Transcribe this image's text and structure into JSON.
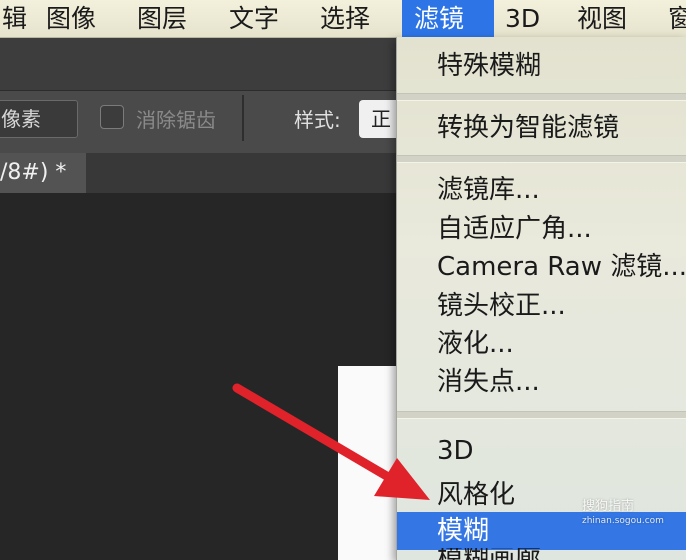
{
  "menubar": {
    "items": [
      {
        "label": "辑"
      },
      {
        "label": "图像"
      },
      {
        "label": "图层"
      },
      {
        "label": "文字"
      },
      {
        "label": "选择"
      },
      {
        "label": "滤镜"
      },
      {
        "label": "3D"
      },
      {
        "label": "视图"
      },
      {
        "label": "窗"
      }
    ]
  },
  "options_bar": {
    "feather_value": "像素",
    "antialias_label": "消除锯齿",
    "style_label": "样式:",
    "style_value": "正"
  },
  "document_tab": {
    "title": "/8#) *"
  },
  "filter_menu": {
    "items": [
      {
        "label": "特殊模糊"
      },
      {
        "label": "转换为智能滤镜"
      },
      {
        "label": "滤镜库..."
      },
      {
        "label": "自适应广角..."
      },
      {
        "label": "Camera Raw 滤镜..."
      },
      {
        "label": "镜头校正..."
      },
      {
        "label": "液化..."
      },
      {
        "label": "消失点..."
      },
      {
        "label": "3D"
      },
      {
        "label": "风格化"
      },
      {
        "label": "模糊"
      },
      {
        "label": "模糊画廊"
      }
    ]
  },
  "watermark": {
    "line1": "搜狗指南",
    "line2": "zhinan.sogou.com"
  },
  "colors": {
    "menu_highlight": "#3376e4",
    "arrow": "#e0222a"
  }
}
